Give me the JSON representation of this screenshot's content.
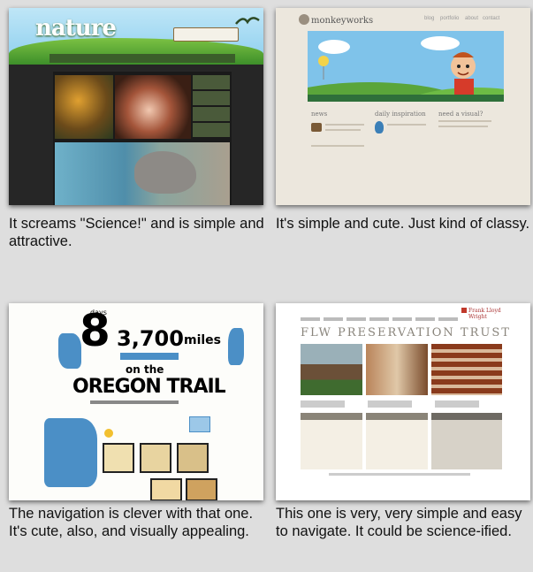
{
  "thumbnails": [
    {
      "site": "nature",
      "caption": "It screams \"Science!\" and is simple and attractive."
    },
    {
      "site": "monkeyworks",
      "nav": [
        "blog",
        "portfolio",
        "about",
        "contact"
      ],
      "section_labels": [
        "news",
        "daily inspiration",
        "need a visual?"
      ],
      "caption": "It's simple and cute. Just kind of classy."
    },
    {
      "site": "oregon-trail",
      "texts": [
        "8",
        "days",
        "3,700",
        "miles",
        "on the",
        "OREGON TRAIL"
      ],
      "caption": "The navigation is clever with that one. It's cute, also, and visually appealing."
    },
    {
      "site": "flw",
      "title": "FLW PRESERVATION TRUST",
      "logo_lines": [
        "Frank Lloyd",
        "Wright"
      ],
      "caption": "This one is very, very simple and easy to navigate. It could be science-ified."
    }
  ]
}
